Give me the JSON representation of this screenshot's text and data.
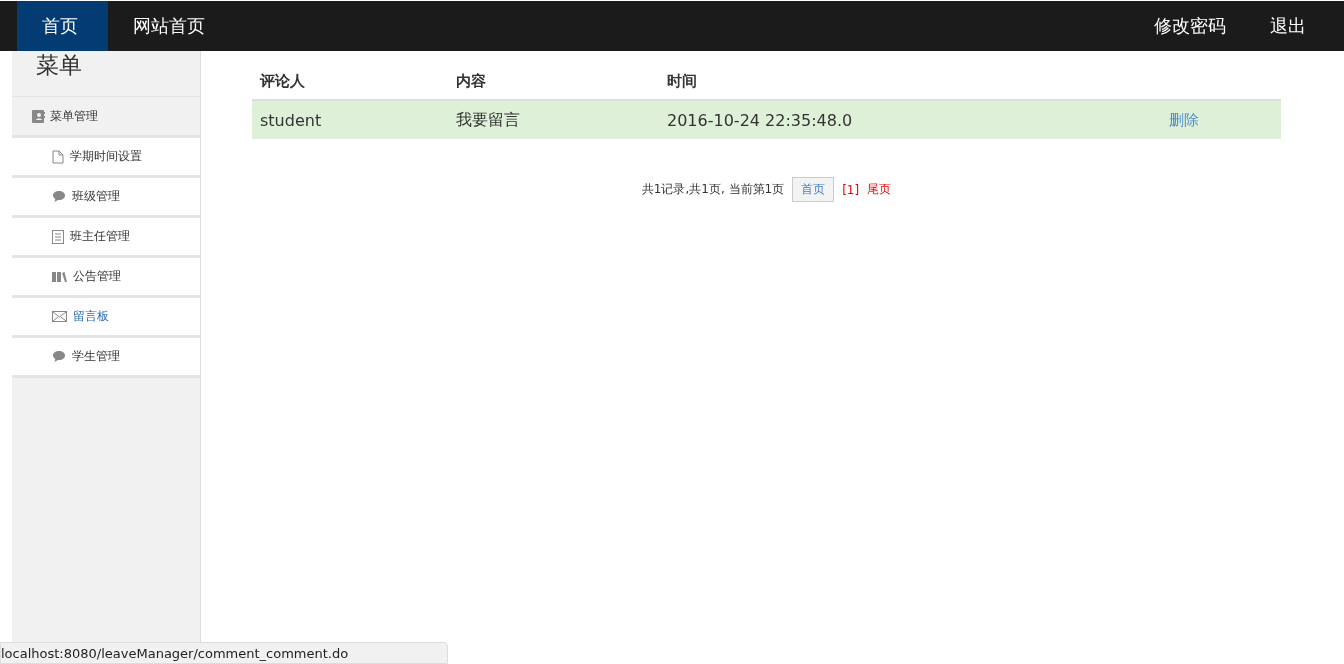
{
  "navbar": {
    "left": [
      {
        "label": "首页",
        "selected": true
      },
      {
        "label": "网站首页",
        "selected": false
      }
    ],
    "right": [
      "修改密码",
      "退出"
    ]
  },
  "sidebar": {
    "title": "菜单",
    "group": "菜单管理",
    "items": [
      {
        "label": "学期时间设置",
        "kind": "document",
        "selected": false
      },
      {
        "label": "班级管理",
        "kind": "comment",
        "selected": false
      },
      {
        "label": "班主任管理",
        "kind": "list",
        "selected": false
      },
      {
        "label": "公告管理",
        "kind": "books",
        "selected": false
      },
      {
        "label": "留言板",
        "kind": "envelope",
        "selected": true
      },
      {
        "label": "学生管理",
        "kind": "comment",
        "selected": false
      }
    ]
  },
  "table": {
    "columns": [
      "评论人",
      "内容",
      "时间"
    ],
    "rows": [
      {
        "cells": [
          "student",
          "我要留言",
          "2016-10-24 22:35:48.0"
        ],
        "action": "删除"
      }
    ]
  },
  "pagination": {
    "summary": "共1记录,共1页, 当前第1页",
    "first": "首页",
    "current": "[1]",
    "last": "尾页"
  },
  "status_bar": "localhost:8080/leaveManager/comment_comment.do"
}
